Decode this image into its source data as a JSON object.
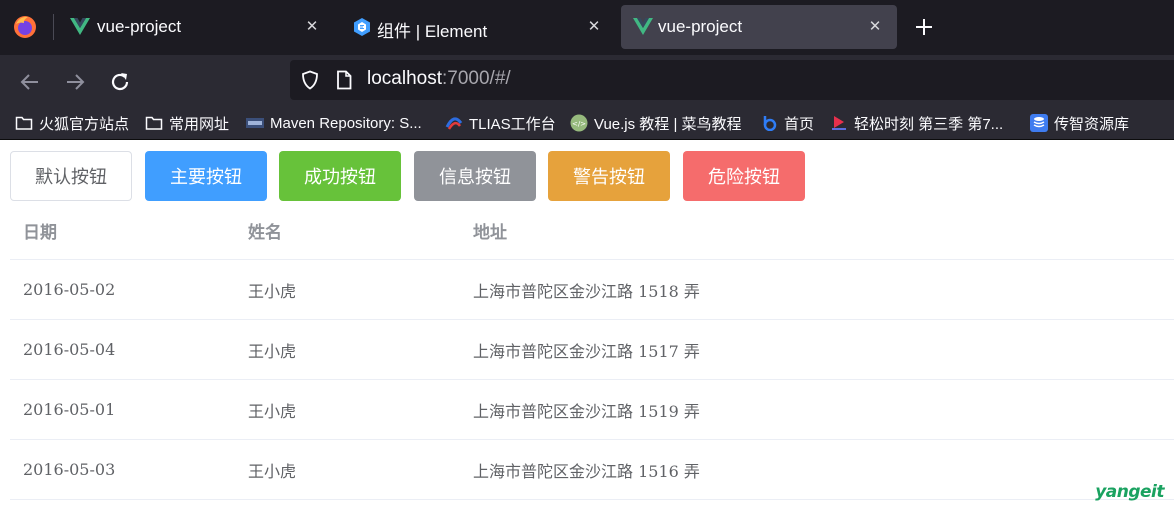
{
  "browser": {
    "tabs": [
      {
        "title": "vue-project",
        "icon": "vue-logo-icon",
        "active": false
      },
      {
        "title": "组件 | Element",
        "icon": "element-logo-icon",
        "active": false
      },
      {
        "title": "vue-project",
        "icon": "vue-logo-icon",
        "active": true
      }
    ],
    "tab_close": "✕",
    "url": {
      "host": "localhost",
      "rest": ":7000/#/"
    },
    "bookmarks": [
      {
        "label": "火狐官方站点",
        "icon": "folder-icon"
      },
      {
        "label": "常用网址",
        "icon": "folder-icon"
      },
      {
        "label": "Maven Repository: S...",
        "icon": "maven-icon"
      },
      {
        "label": "TLIAS工作台",
        "icon": "tlias-icon"
      },
      {
        "label": "Vue.js 教程 | 菜鸟教程",
        "icon": "runoob-icon"
      },
      {
        "label": "首页",
        "icon": "b-logo-icon"
      },
      {
        "label": "轻松时刻 第三季 第7...",
        "icon": "video-icon"
      },
      {
        "label": "传智资源库",
        "icon": "database-icon"
      }
    ]
  },
  "buttons": [
    {
      "label": "默认按钮",
      "type": "default",
      "color": "#ffffff"
    },
    {
      "label": "主要按钮",
      "type": "primary",
      "color": "#409eff"
    },
    {
      "label": "成功按钮",
      "type": "success",
      "color": "#67c23a"
    },
    {
      "label": "信息按钮",
      "type": "info",
      "color": "#909399"
    },
    {
      "label": "警告按钮",
      "type": "warning",
      "color": "#e6a23c"
    },
    {
      "label": "危险按钮",
      "type": "danger",
      "color": "#f56c6c"
    }
  ],
  "table": {
    "headers": [
      "日期",
      "姓名",
      "地址"
    ],
    "rows": [
      [
        "2016-05-02",
        "王小虎",
        "上海市普陀区金沙江路 1518 弄"
      ],
      [
        "2016-05-04",
        "王小虎",
        "上海市普陀区金沙江路 1517 弄"
      ],
      [
        "2016-05-01",
        "王小虎",
        "上海市普陀区金沙江路 1519 弄"
      ],
      [
        "2016-05-03",
        "王小虎",
        "上海市普陀区金沙江路 1516 弄"
      ]
    ]
  },
  "watermark": "yangeit"
}
